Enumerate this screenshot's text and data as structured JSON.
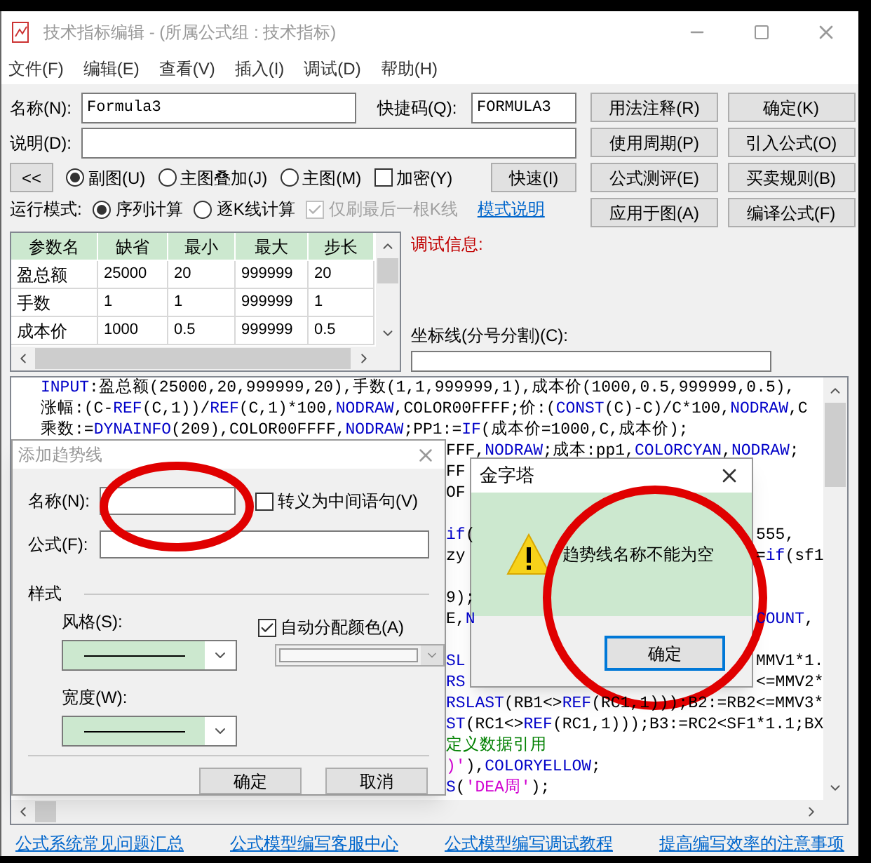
{
  "window": {
    "title": "技术指标编辑 - (所属公式组 : 技术指标)"
  },
  "menu": [
    "文件(F)",
    "编辑(E)",
    "查看(V)",
    "插入(I)",
    "调试(D)",
    "帮助(H)"
  ],
  "form": {
    "name_label": "名称(N):",
    "name_value": "Formula3",
    "shortcut_label": "快捷码(Q):",
    "shortcut_value": "FORMULA3",
    "desc_label": "说明(D):"
  },
  "side_buttons": [
    "用法注释(R)",
    "确定(K)",
    "使用周期(P)",
    "引入公式(O)",
    "公式测评(E)",
    "买卖规则(B)",
    "应用于图(A)",
    "编译公式(F)"
  ],
  "collapse_button": "<<",
  "chart_type": [
    {
      "label": "副图(U)",
      "selected": true
    },
    {
      "label": "主图叠加(J)",
      "selected": false
    },
    {
      "label": "主图(M)",
      "selected": false
    }
  ],
  "encrypt": {
    "label": "加密(Y)",
    "checked": false
  },
  "fast_button": "快速(I)",
  "run_mode": {
    "label": "运行模式:",
    "options": [
      {
        "label": "序列计算",
        "selected": true
      },
      {
        "label": "逐K线计算",
        "selected": false
      }
    ],
    "refresh_last": {
      "label": "仅刷最后一根K线",
      "checked": true,
      "disabled": true
    },
    "help_link": "模式说明"
  },
  "params": {
    "columns": [
      "参数名",
      "缺省",
      "最小",
      "最大",
      "步长"
    ],
    "rows": [
      [
        "盈总额",
        "25000",
        "20",
        "999999",
        "20"
      ],
      [
        "手数",
        "1",
        "1",
        "999999",
        "1"
      ],
      [
        "成本价",
        "1000",
        "0.5",
        "999999",
        "0.5"
      ]
    ]
  },
  "debug": {
    "label": "调试信息:"
  },
  "axis_lines": {
    "label": "坐标线(分号分割)(C):"
  },
  "code_lines": [
    {
      "kind": "full",
      "fragments": [
        [
          {
            "kind": "keyword",
            "text": "INPUT"
          },
          {
            "kind": "plain",
            "text": ":盈总额(25000,20,999999,20),手数(1,1,999999,1),成本价(1000,0.5,999999,0.5),"
          }
        ]
      ]
    },
    {
      "kind": "full",
      "fragments": [
        [
          {
            "kind": "plain",
            "text": "涨幅:(C-"
          },
          {
            "kind": "keyword",
            "text": "REF"
          },
          {
            "kind": "plain",
            "text": "(C,1))/"
          },
          {
            "kind": "keyword",
            "text": "REF"
          },
          {
            "kind": "plain",
            "text": "(C,1)*100,"
          },
          {
            "kind": "keyword",
            "text": "NODRAW"
          },
          {
            "kind": "plain",
            "text": ",COLOR00FFFF;价:("
          },
          {
            "kind": "keyword",
            "text": "CONST"
          },
          {
            "kind": "plain",
            "text": "(C)-C)/C*100,"
          },
          {
            "kind": "keyword",
            "text": "NODRAW"
          },
          {
            "kind": "plain",
            "text": ",C"
          }
        ]
      ]
    },
    {
      "kind": "full",
      "fragments": [
        [
          {
            "kind": "plain",
            "text": "乘数:="
          },
          {
            "kind": "keyword",
            "text": "DYNAINFO"
          },
          {
            "kind": "plain",
            "text": "(209),COLOR00FFFF,"
          },
          {
            "kind": "keyword",
            "text": "NODRAW"
          },
          {
            "kind": "plain",
            "text": ";PP1:="
          },
          {
            "kind": "keyword",
            "text": "IF"
          },
          {
            "kind": "plain",
            "text": "(成本价=1000,C,成本价);"
          }
        ]
      ]
    },
    {
      "kind": "right",
      "fragments": [
        [
          {
            "kind": "plain",
            "text": "FFF,"
          },
          {
            "kind": "keyword",
            "text": "NODRAW"
          },
          {
            "kind": "plain",
            "text": ";成本:pp1,"
          },
          {
            "kind": "keyword",
            "text": "COLORCYAN"
          },
          {
            "kind": "plain",
            "text": ","
          },
          {
            "kind": "keyword",
            "text": "NODRAW"
          },
          {
            "kind": "plain",
            "text": ";"
          }
        ]
      ]
    },
    {
      "kind": "split",
      "fragments": [
        [
          {
            "kind": "plain",
            "text": "FF"
          }
        ]
      ]
    },
    {
      "kind": "split",
      "fragments": [
        [
          {
            "kind": "plain",
            "text": "OF"
          }
        ]
      ]
    },
    {
      "kind": "blank"
    },
    {
      "kind": "split",
      "fragments": [
        [
          {
            "kind": "keyword",
            "text": "if"
          },
          {
            "kind": "plain",
            "text": "("
          }
        ],
        [
          {
            "kind": "plain",
            "text": "555,"
          }
        ]
      ]
    },
    {
      "kind": "split",
      "fragments": [
        [
          {
            "kind": "plain",
            "text": "zy"
          }
        ],
        [
          {
            "kind": "plain",
            "text": "="
          },
          {
            "kind": "keyword",
            "text": "if"
          },
          {
            "kind": "plain",
            "text": "(sf1"
          }
        ]
      ]
    },
    {
      "kind": "blank"
    },
    {
      "kind": "split",
      "fragments": [
        [
          {
            "kind": "plain",
            "text": "9);"
          }
        ]
      ]
    },
    {
      "kind": "split",
      "fragments": [
        [
          {
            "kind": "plain",
            "text": "E,"
          },
          {
            "kind": "keyword",
            "text": "N"
          }
        ],
        [
          {
            "kind": "keyword",
            "text": "COUNT"
          },
          {
            "kind": "plain",
            "text": ","
          }
        ]
      ]
    },
    {
      "kind": "blank"
    },
    {
      "kind": "split",
      "fragments": [
        [
          {
            "kind": "keyword",
            "text": "SL"
          }
        ],
        [
          {
            "kind": "plain",
            "text": "MMV1*1."
          }
        ]
      ]
    },
    {
      "kind": "split",
      "fragments": [
        [
          {
            "kind": "keyword",
            "text": "RS"
          }
        ],
        [
          {
            "kind": "plain",
            "text": "<=MMV2*"
          }
        ]
      ]
    },
    {
      "kind": "right",
      "fragments": [
        [
          {
            "kind": "keyword",
            "text": "RSLAST"
          },
          {
            "kind": "plain",
            "text": "(RB1<>"
          },
          {
            "kind": "keyword",
            "text": "REF"
          },
          {
            "kind": "plain",
            "text": "(RC1,1)));B2:=RB2<=MMV3*"
          }
        ]
      ]
    },
    {
      "kind": "right",
      "fragments": [
        [
          {
            "kind": "keyword",
            "text": "ST"
          },
          {
            "kind": "plain",
            "text": "(RC1<>"
          },
          {
            "kind": "keyword",
            "text": "REF"
          },
          {
            "kind": "plain",
            "text": "(RC1,1)));B3:=RC2<SF1*1.1;BX"
          }
        ]
      ]
    },
    {
      "kind": "right",
      "fragments": [
        [
          {
            "kind": "comment",
            "text": "定义数据引用"
          }
        ]
      ]
    },
    {
      "kind": "right",
      "fragments": [
        [
          {
            "kind": "string",
            "text": ")'"
          },
          {
            "kind": "plain",
            "text": "),"
          },
          {
            "kind": "keyword",
            "text": "COLORYELLOW"
          },
          {
            "kind": "plain",
            "text": ";"
          }
        ]
      ]
    },
    {
      "kind": "right",
      "fragments": [
        [
          {
            "kind": "keyword",
            "text": "S"
          },
          {
            "kind": "plain",
            "text": "("
          },
          {
            "kind": "string",
            "text": "'DEA周'"
          },
          {
            "kind": "plain",
            "text": ");"
          }
        ]
      ]
    }
  ],
  "links": [
    "公式系统常见问题汇总",
    "公式模型编写客服中心",
    "公式模型编写调试教程",
    "提高编写效率的注意事项"
  ],
  "trend_dialog": {
    "title": "添加趋势线",
    "name_label": "名称(N):",
    "escape": {
      "label": "转义为中间语句(V)",
      "checked": false
    },
    "formula_label": "公式(F):",
    "style_group": "样式",
    "style_label": "风格(S):",
    "auto_color": {
      "label": "自动分配颜色(A)",
      "checked": true
    },
    "width_label": "宽度(W):",
    "buttons": [
      "确定",
      "取消"
    ]
  },
  "message_box": {
    "title": "金字塔",
    "message": "趋势线名称不能为空",
    "button": "确定"
  }
}
